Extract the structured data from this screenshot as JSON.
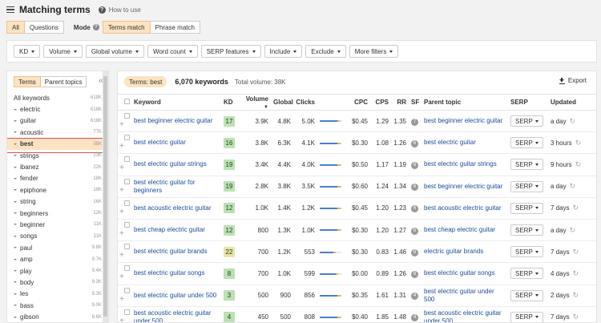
{
  "header": {
    "title": "Matching terms",
    "howto": "How to use"
  },
  "filters": {
    "scope": [
      "All",
      "Questions"
    ],
    "mode_label": "Mode",
    "modes": [
      "Terms match",
      "Phrase match"
    ]
  },
  "toolbar": [
    "KD",
    "Volume",
    "Global volume",
    "Word count",
    "SERP features",
    "Include",
    "Exclude",
    "More filters"
  ],
  "sidebar": {
    "tabs": [
      "Terms",
      "Parent topics"
    ],
    "collapse": "«",
    "items": [
      {
        "name": "All keywords",
        "count": "618K"
      },
      {
        "name": "electric",
        "count": "618K"
      },
      {
        "name": "guitar",
        "count": "618K"
      },
      {
        "name": "acoustic",
        "count": "77K"
      },
      {
        "name": "best",
        "count": "38K"
      },
      {
        "name": "strings",
        "count": "23K"
      },
      {
        "name": "ibanez",
        "count": "22K"
      },
      {
        "name": "fender",
        "count": "18K"
      },
      {
        "name": "epiphone",
        "count": "18K"
      },
      {
        "name": "string",
        "count": "16K"
      },
      {
        "name": "beginners",
        "count": "12K"
      },
      {
        "name": "beginner",
        "count": "11K"
      },
      {
        "name": "songs",
        "count": "11K"
      },
      {
        "name": "paul",
        "count": "9.8K"
      },
      {
        "name": "amp",
        "count": "9.7K"
      },
      {
        "name": "play",
        "count": "9.4K"
      },
      {
        "name": "body",
        "count": "9.3K"
      },
      {
        "name": "les",
        "count": "9.3K"
      },
      {
        "name": "bass",
        "count": "9.0K"
      },
      {
        "name": "gibson",
        "count": "8.6K"
      }
    ]
  },
  "main": {
    "terms_pill": "Terms: best",
    "keyword_count": "6,070 keywords",
    "total_volume": "Total volume: 38K",
    "export": "Export",
    "columns": [
      "Keyword",
      "KD",
      "Volume",
      "Global",
      "Clicks",
      "CPC",
      "CPS",
      "RR",
      "SF",
      "Parent topic",
      "SERP",
      "Updated"
    ],
    "rows": [
      {
        "keyword": "best beginner electric guitar",
        "kd": "17",
        "kd_color": "#b9e3b0",
        "volume": "3.9K",
        "global": "4.8K",
        "clicks": "5.0K",
        "paid": 0.78,
        "cpc": "$0.45",
        "cps": "1.29",
        "rr": "1.35",
        "sf": "7",
        "parent": "best beginner electric guitar",
        "serp": "SERP",
        "updated": "a day"
      },
      {
        "keyword": "best electric guitar",
        "kd": "16",
        "kd_color": "#b9e3b0",
        "volume": "3.8K",
        "global": "6.3K",
        "clicks": "4.1K",
        "paid": 0.8,
        "cpc": "$0.30",
        "cps": "1.08",
        "rr": "1.26",
        "sf": "6",
        "parent": "best electric guitar",
        "serp": "SERP",
        "updated": "3 hours"
      },
      {
        "keyword": "best electric guitar strings",
        "kd": "19",
        "kd_color": "#b9e3b0",
        "volume": "3.4K",
        "global": "4.4K",
        "clicks": "4.0K",
        "paid": 0.8,
        "cpc": "$0.50",
        "cps": "1.17",
        "rr": "1.19",
        "sf": "8",
        "parent": "best electric guitar strings",
        "serp": "SERP",
        "updated": "9 hours"
      },
      {
        "keyword": "best electric guitar for beginners",
        "kd": "19",
        "kd_color": "#b9e3b0",
        "volume": "2.8K",
        "global": "3.8K",
        "clicks": "3.5K",
        "paid": 0.8,
        "cpc": "$0.60",
        "cps": "1.24",
        "rr": "1.34",
        "sf": "6",
        "parent": "best beginner electric guitar",
        "serp": "SERP",
        "updated": "a day"
      },
      {
        "keyword": "best acoustic electric guitar",
        "kd": "12",
        "kd_color": "#b9e3b0",
        "volume": "1.0K",
        "global": "1.4K",
        "clicks": "1.2K",
        "paid": 0.8,
        "cpc": "$0.45",
        "cps": "1.20",
        "rr": "1.23",
        "sf": "6",
        "parent": "best acoustic electric guitar",
        "serp": "SERP",
        "updated": "7 days"
      },
      {
        "keyword": "best cheap electric guitar",
        "kd": "12",
        "kd_color": "#b9e3b0",
        "volume": "800",
        "global": "1.3K",
        "clicks": "1.0K",
        "paid": 0.8,
        "cpc": "$0.30",
        "cps": "1.20",
        "rr": "1.27",
        "sf": "6",
        "parent": "best cheap electric guitar",
        "serp": "SERP",
        "updated": "a day"
      },
      {
        "keyword": "best electric guitar brands",
        "kd": "22",
        "kd_color": "#e6e6a8",
        "volume": "700",
        "global": "1.2K",
        "clicks": "553",
        "paid": 0.6,
        "cpc": "$0.30",
        "cps": "0.83",
        "rr": "1.46",
        "sf": "6",
        "parent": "electric guitar brands",
        "serp": "SERP",
        "updated": "7 days"
      },
      {
        "keyword": "best electric guitar songs",
        "kd": "8",
        "kd_color": "#b9e3b0",
        "volume": "700",
        "global": "1.0K",
        "clicks": "599",
        "paid": 0.7,
        "cpc": "$0.00",
        "cps": "0.89",
        "rr": "1.26",
        "sf": "6",
        "parent": "best electric guitar songs",
        "serp": "SERP",
        "updated": "4 days"
      },
      {
        "keyword": "best electric guitar under 500",
        "kd": "3",
        "kd_color": "#b9e3b0",
        "volume": "500",
        "global": "900",
        "clicks": "856",
        "paid": 0.8,
        "cpc": "$0.35",
        "cps": "1.61",
        "rr": "1.31",
        "sf": "4",
        "parent": "best electric guitar under 500",
        "serp": "SERP",
        "updated": "2 days"
      },
      {
        "keyword": "best acoustic electric guitar under 500",
        "kd": "4",
        "kd_color": "#b9e3b0",
        "volume": "450",
        "global": "500",
        "clicks": "808",
        "paid": 0.8,
        "cpc": "$0.40",
        "cps": "1.85",
        "rr": "1.48",
        "sf": "4",
        "parent": "best acoustic electric guitar under 500",
        "serp": "SERP",
        "updated": "7 days"
      }
    ]
  }
}
